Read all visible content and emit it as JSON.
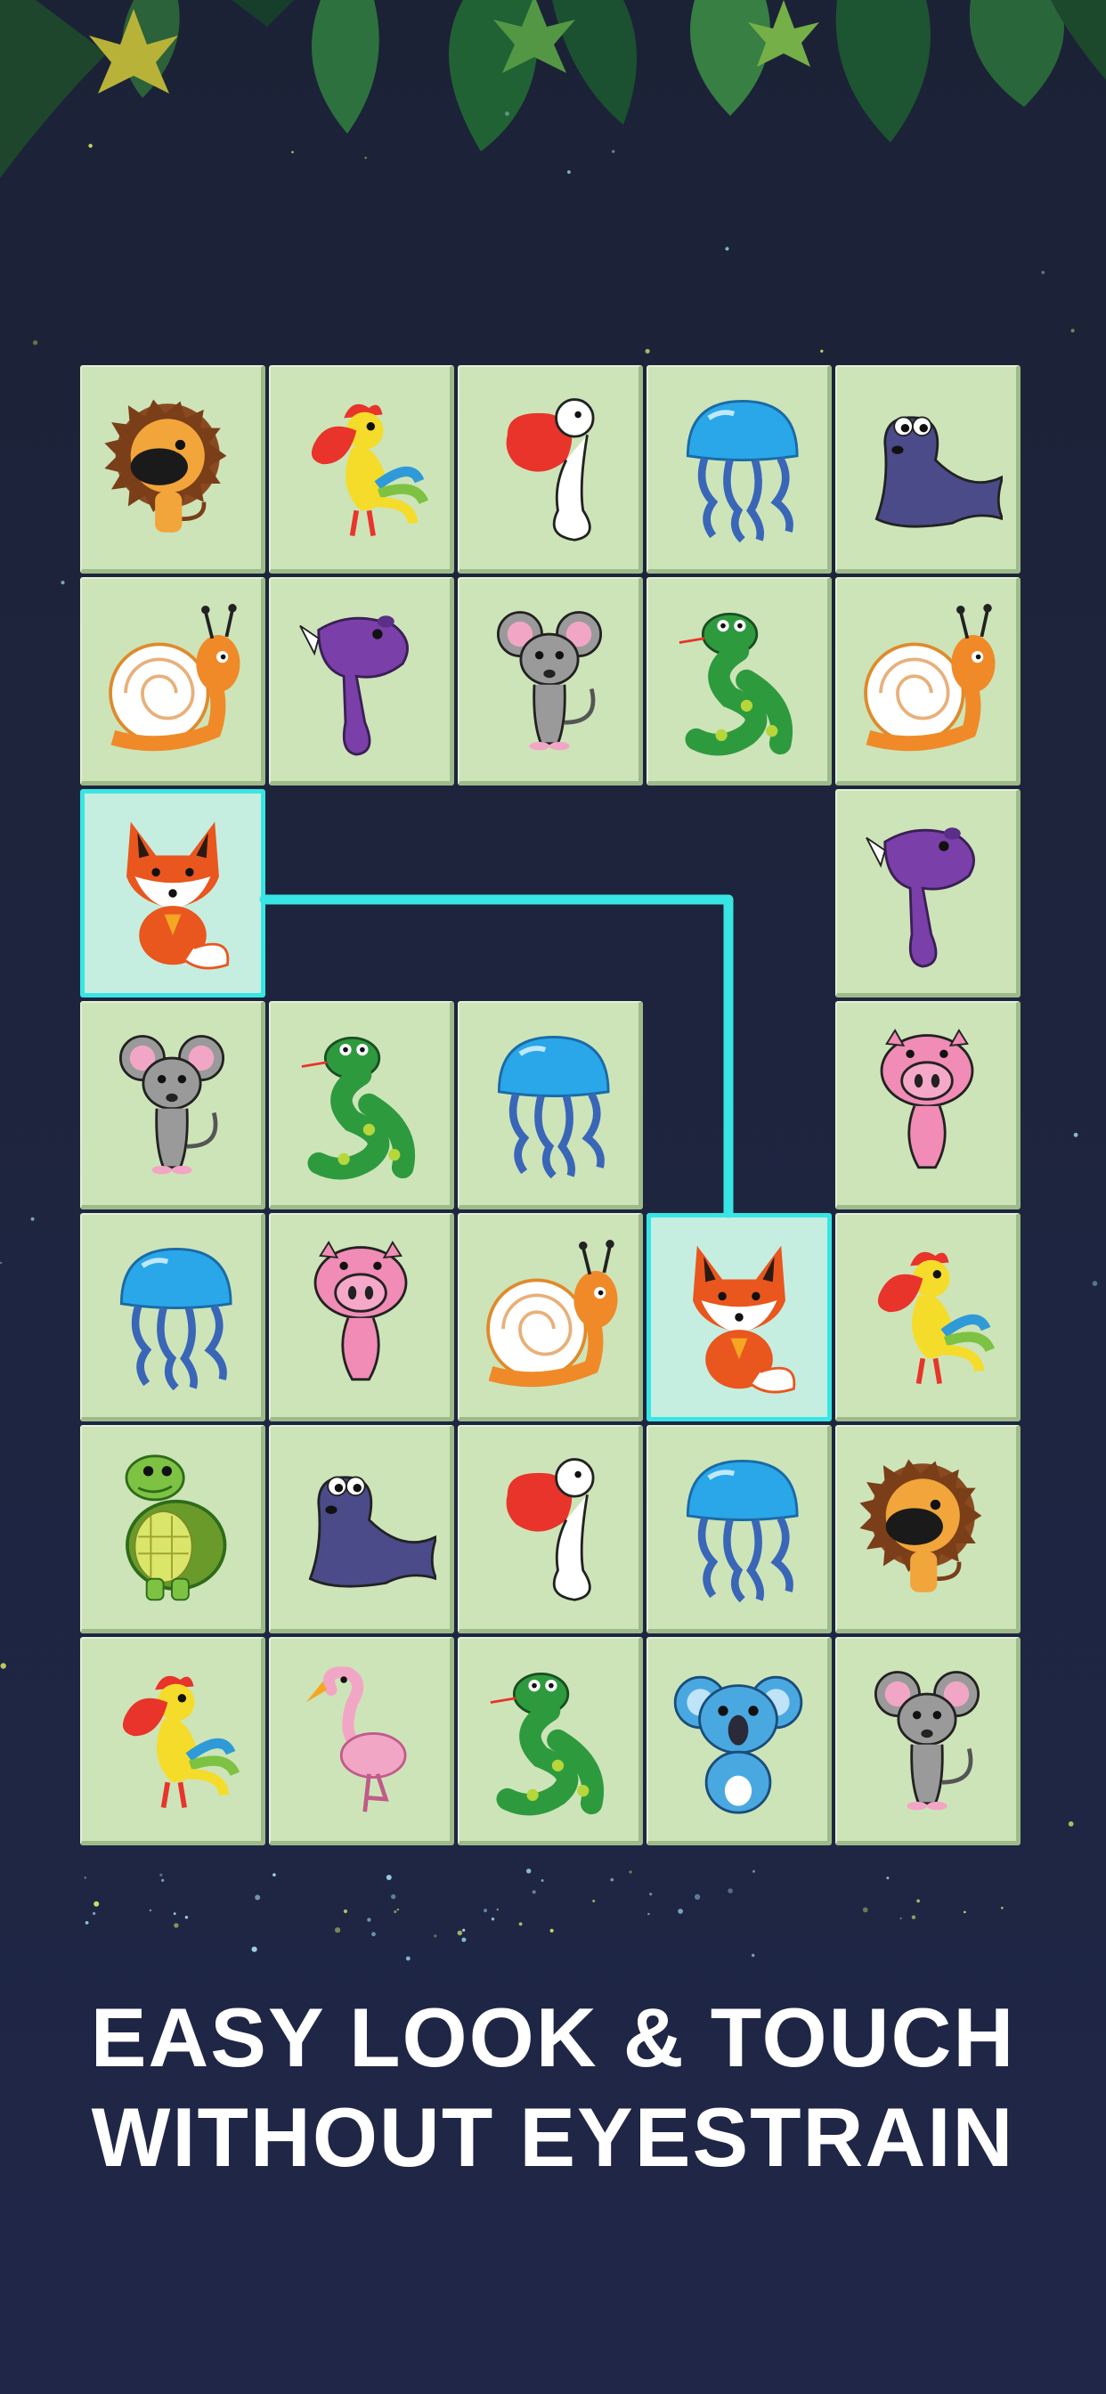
{
  "headline": {
    "line1": "EASY LOOK & TOUCH",
    "line2": "WITHOUT EYESTRAIN"
  },
  "colors": {
    "background": "#1e2540",
    "tile": "#cde4b9",
    "tile_selected": "#c5eee0",
    "highlight": "#37e6e4"
  },
  "board": {
    "columns": 5,
    "rows": 7,
    "cells": [
      [
        "lion",
        "rooster",
        "pelican",
        "jellyfish",
        "seal"
      ],
      [
        "snail",
        "rhino",
        "mouse",
        "snake",
        "snail"
      ],
      [
        "fox",
        "",
        "",
        "",
        "rhino"
      ],
      [
        "mouse",
        "snake",
        "jellyfish",
        "",
        "pig"
      ],
      [
        "jellyfish",
        "pig",
        "snail",
        "fox",
        "rooster"
      ],
      [
        "turtle",
        "seal",
        "pelican",
        "jellyfish",
        "lion"
      ],
      [
        "rooster",
        "flamingo",
        "snake",
        "koala",
        "mouse"
      ]
    ],
    "selected": [
      [
        2,
        0
      ],
      [
        4,
        3
      ]
    ]
  }
}
